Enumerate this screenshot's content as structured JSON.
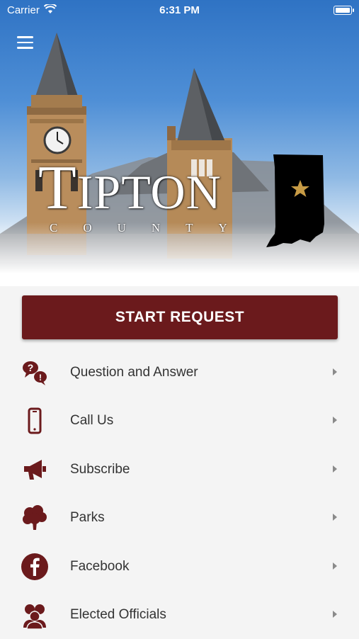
{
  "status_bar": {
    "carrier": "Carrier",
    "time": "6:31 PM"
  },
  "header": {
    "logo_title_first": "T",
    "logo_title_rest": "IPTON",
    "logo_subtitle": "COUNTY"
  },
  "start_button": {
    "label": "START REQUEST"
  },
  "menu": {
    "items": [
      {
        "label": "Question and Answer",
        "icon": "question-answer-icon"
      },
      {
        "label": "Call Us",
        "icon": "phone-icon"
      },
      {
        "label": "Subscribe",
        "icon": "megaphone-icon"
      },
      {
        "label": "Parks",
        "icon": "tree-icon"
      },
      {
        "label": "Facebook",
        "icon": "facebook-icon"
      },
      {
        "label": "Elected Officials",
        "icon": "people-icon"
      }
    ]
  },
  "colors": {
    "accent": "#6b1a1c",
    "icon": "#6b1a1c",
    "background": "#f4f4f4"
  }
}
